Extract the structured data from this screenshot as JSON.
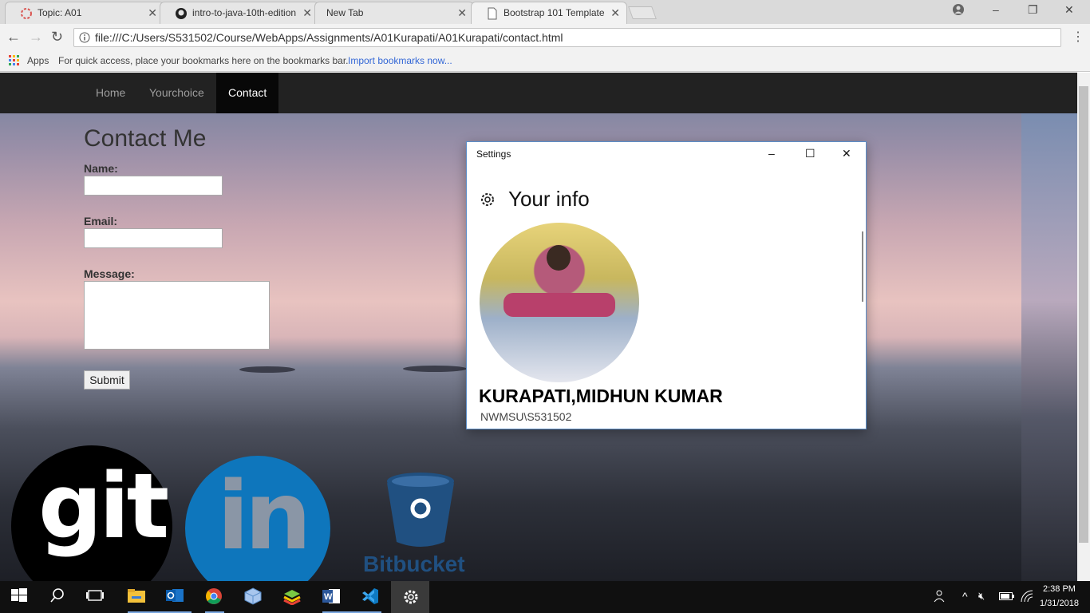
{
  "browser": {
    "tabs": [
      {
        "label": "Topic: A01",
        "icon": "topic-icon"
      },
      {
        "label": "intro-to-java-10th-edition",
        "icon": "github-icon"
      },
      {
        "label": "New Tab",
        "icon": ""
      },
      {
        "label": "Bootstrap 101 Template",
        "icon": "page-icon"
      }
    ],
    "url": "file:///C:/Users/S531502/Course/WebApps/Assignments/A01Kurapati/A01Kurapati/contact.html",
    "bookmarks_bar": {
      "apps_label": "Apps",
      "hint": "For quick access, place your bookmarks here on the bookmarks bar.",
      "import_link": "Import bookmarks now..."
    }
  },
  "page": {
    "nav": [
      "Home",
      "Yourchoice",
      "Contact"
    ],
    "active_nav": "Contact",
    "heading": "Contact Me",
    "form": {
      "name_label": "Name:",
      "email_label": "Email:",
      "message_label": "Message:",
      "submit_label": "Submit"
    },
    "logos": [
      "git",
      "in",
      "Bitbucket"
    ]
  },
  "dialog": {
    "window_title": "Settings",
    "heading": "Your info",
    "user_name": "KURAPATI,MIDHUN KUMAR",
    "account": "NWMSU\\S531502"
  },
  "taskbar": {
    "time": "2:38 PM",
    "date": "1/31/2018"
  },
  "colors": {
    "navbar": "#222222",
    "linkedin": "#0e76bc",
    "bitbucket": "#205081",
    "dialog_border": "#5b8ec9"
  }
}
